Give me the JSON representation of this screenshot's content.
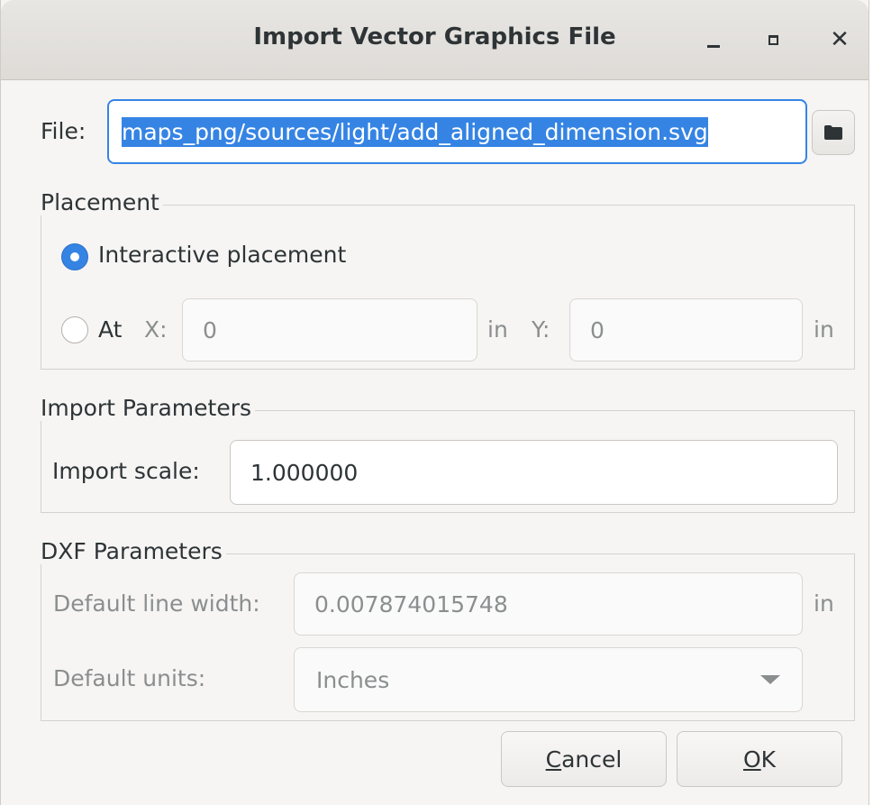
{
  "window": {
    "title": "Import Vector Graphics File",
    "controls": [
      "minimize-icon",
      "maximize-icon",
      "close-icon"
    ]
  },
  "file": {
    "label": "File:",
    "value": "maps_png/sources/light/add_aligned_dimension.svg",
    "browse_icon": "folder-icon"
  },
  "placement": {
    "title": "Placement",
    "interactive_label": "Interactive placement",
    "interactive_selected": true,
    "at_label": "At",
    "x_label": "X:",
    "x_value": "0",
    "x_unit": "in",
    "y_label": "Y:",
    "y_value": "0",
    "y_unit": "in"
  },
  "import_params": {
    "title": "Import Parameters",
    "scale_label": "Import scale:",
    "scale_value": "1.000000"
  },
  "dxf_params": {
    "title": "DXF Parameters",
    "line_width_label": "Default line width:",
    "line_width_value": "0.007874015748",
    "line_width_unit": "in",
    "units_label": "Default units:",
    "units_value": "Inches"
  },
  "buttons": {
    "cancel_mnemonic": "C",
    "cancel_rest": "ancel",
    "ok_mnemonic": "O",
    "ok_rest": "K"
  },
  "colors": {
    "accent": "#3584e4",
    "window_bg": "#f6f5f4",
    "text": "#2e3436",
    "disabled_text": "#8b8e8f"
  }
}
